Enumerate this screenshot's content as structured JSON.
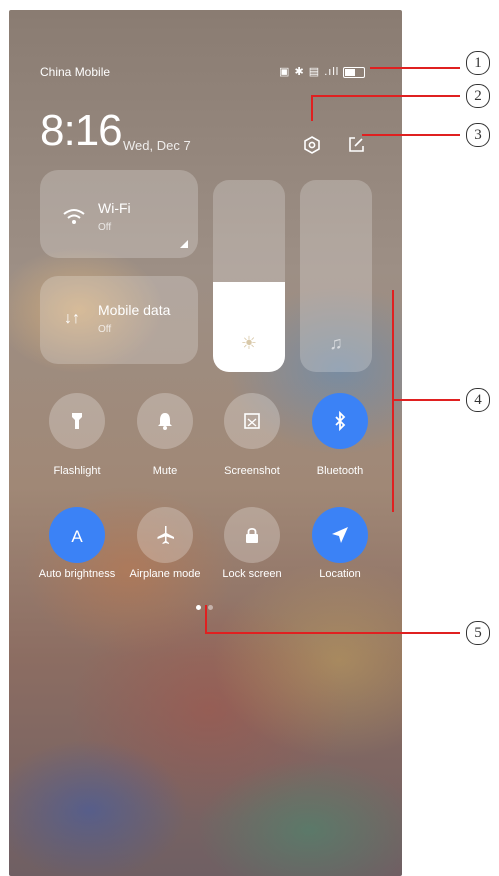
{
  "status_bar": {
    "carrier": "China Mobile",
    "icons": [
      "nfc-icon",
      "bluetooth-icon",
      "sim-icon",
      "signal-icon",
      "battery-icon"
    ]
  },
  "header": {
    "time": "8:16",
    "date": "Wed, Dec 7"
  },
  "tiles": {
    "wifi": {
      "label": "Wi-Fi",
      "status": "Off"
    },
    "mobile_data": {
      "label": "Mobile data",
      "status": "Off"
    }
  },
  "sliders": {
    "brightness_level": 0.47,
    "volume_level": 0.0
  },
  "toggles": [
    {
      "label": "Flashlight",
      "icon": "flashlight-icon",
      "on": false
    },
    {
      "label": "Mute",
      "icon": "bell-icon",
      "on": false
    },
    {
      "label": "Screenshot",
      "icon": "screenshot-icon",
      "on": false
    },
    {
      "label": "Bluetooth",
      "icon": "bluetooth-icon",
      "on": true
    },
    {
      "label": "Auto brightness",
      "icon": "auto-brightness-icon",
      "on": true
    },
    {
      "label": "Airplane mode",
      "icon": "airplane-icon",
      "on": false
    },
    {
      "label": "Lock screen",
      "icon": "lock-icon",
      "on": false
    },
    {
      "label": "Location",
      "icon": "location-icon",
      "on": true
    }
  ],
  "page_indicator": {
    "current": 1,
    "total": 2
  },
  "callouts": [
    "1",
    "2",
    "3",
    "4",
    "5"
  ],
  "colors": {
    "accent": "#3b82f6",
    "callout_line": "#e02020"
  }
}
